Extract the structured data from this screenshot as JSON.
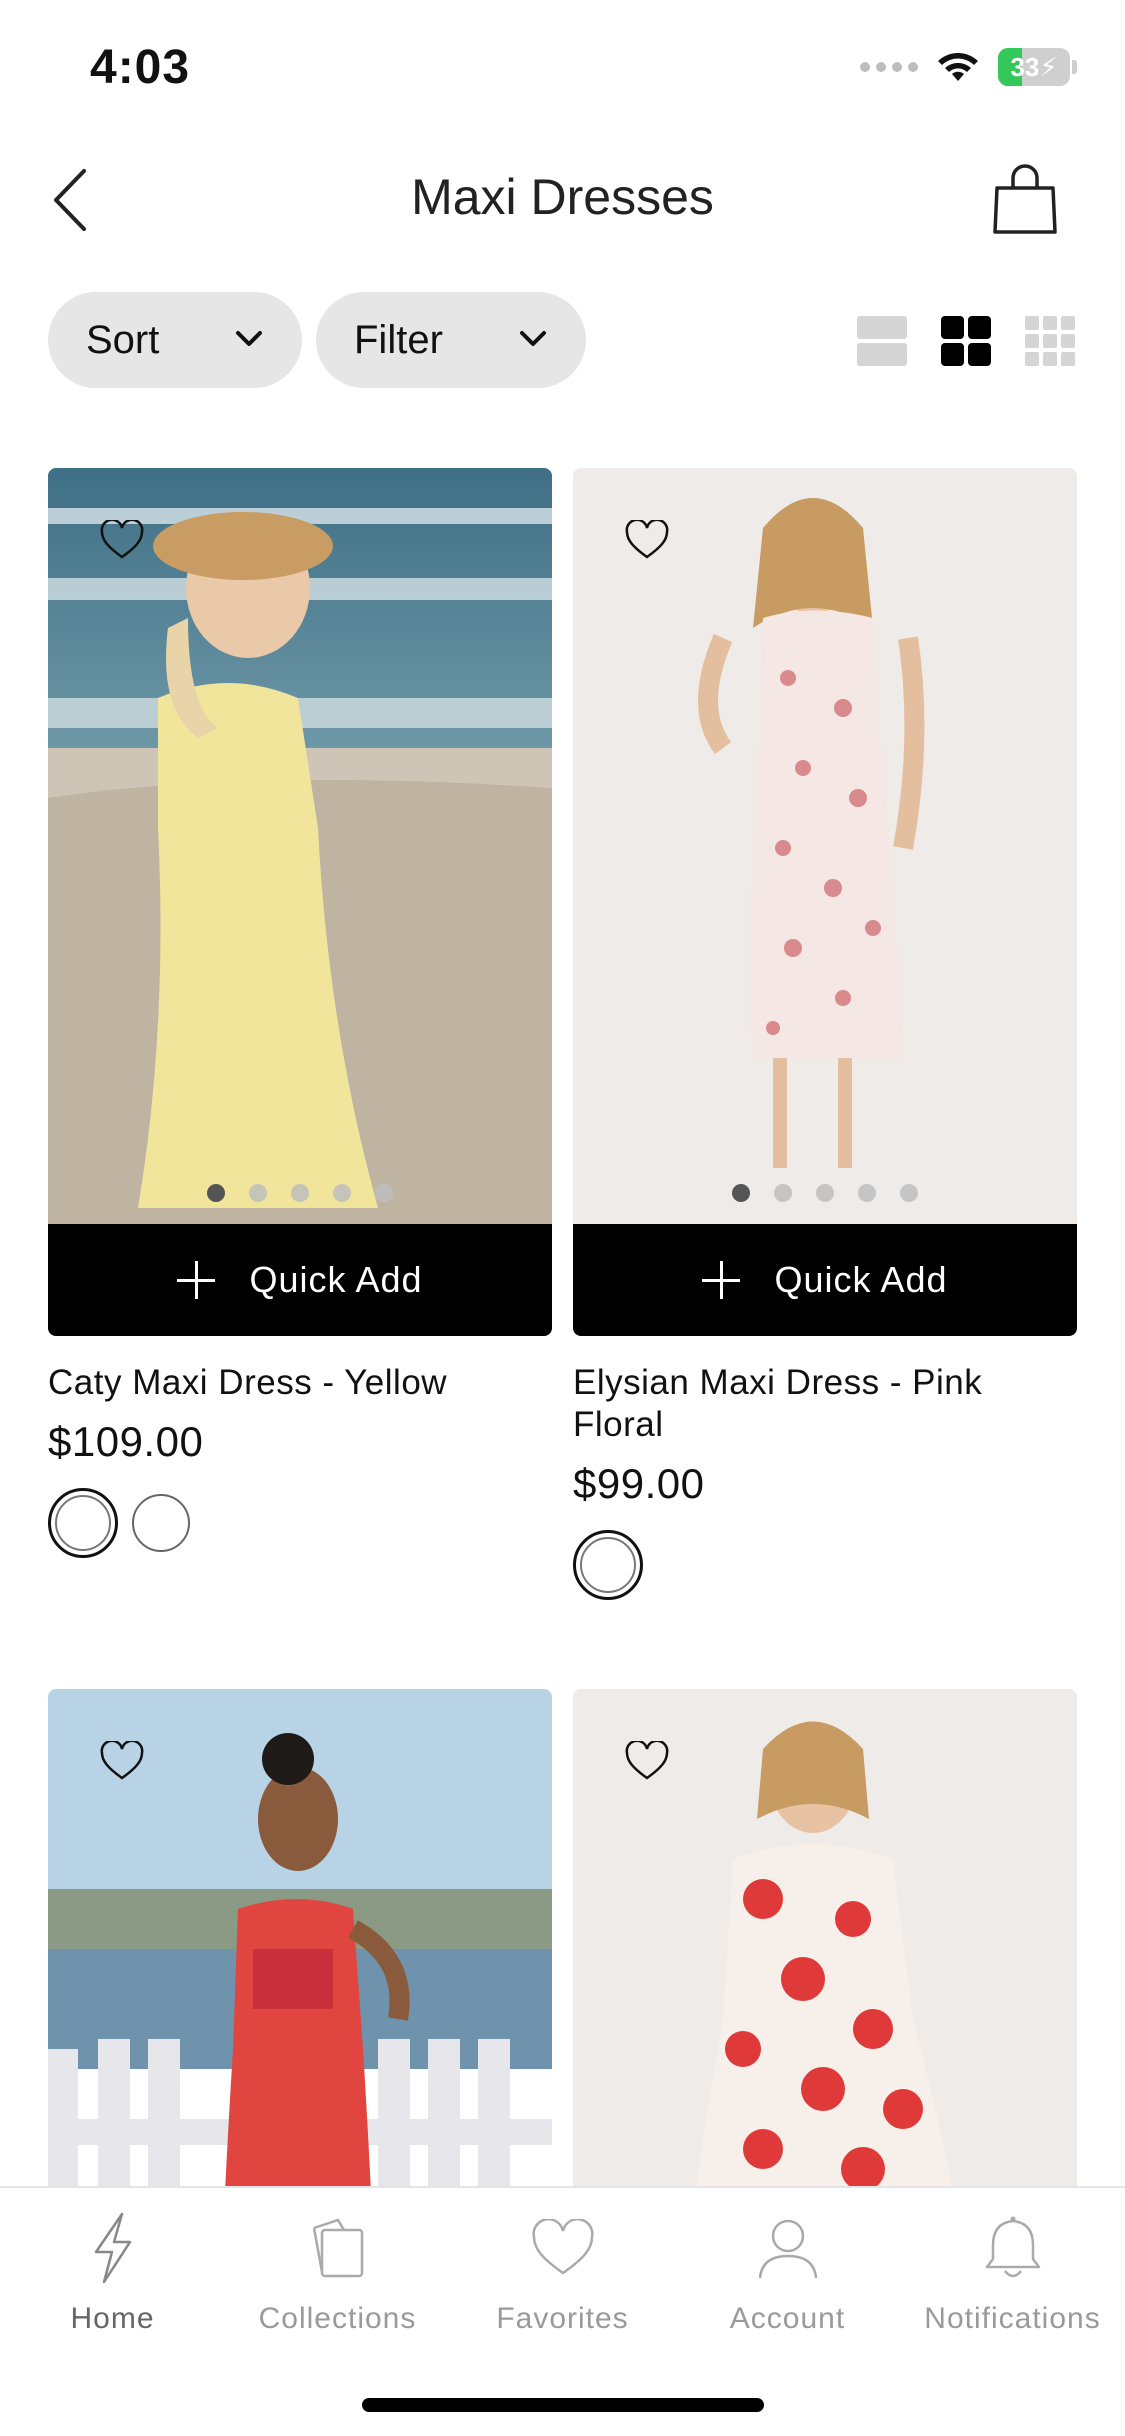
{
  "status_bar": {
    "time": "4:03",
    "battery": "33",
    "battery_level": 0.33
  },
  "header": {
    "title": "Maxi Dresses"
  },
  "toolbar": {
    "sort_label": "Sort",
    "filter_label": "Filter",
    "active_view": "grid-2"
  },
  "products": [
    {
      "name": "Caty Maxi Dress - Yellow",
      "price": "$109.00",
      "quick_add": "Quick Add",
      "image_dots": 5,
      "active_dot": 0,
      "swatch_count": 2
    },
    {
      "name": "Elysian Maxi Dress - Pink Floral",
      "price": "$99.00",
      "quick_add": "Quick Add",
      "image_dots": 5,
      "active_dot": 0,
      "swatch_count": 1
    },
    {
      "name": "",
      "price": ""
    },
    {
      "name": "",
      "price": ""
    }
  ],
  "tabbar": {
    "items": [
      {
        "label": "Home",
        "icon": "lightning-icon",
        "active": true
      },
      {
        "label": "Collections",
        "icon": "collections-icon",
        "active": false
      },
      {
        "label": "Favorites",
        "icon": "heart-icon",
        "active": false
      },
      {
        "label": "Account",
        "icon": "person-icon",
        "active": false
      },
      {
        "label": "Notifications",
        "icon": "bell-icon",
        "active": false
      }
    ]
  },
  "colors": {
    "accent": "#000000",
    "pill_bg": "#e6e6e6",
    "tab_label": "#9a9a9a",
    "battery_green": "#34c759"
  }
}
